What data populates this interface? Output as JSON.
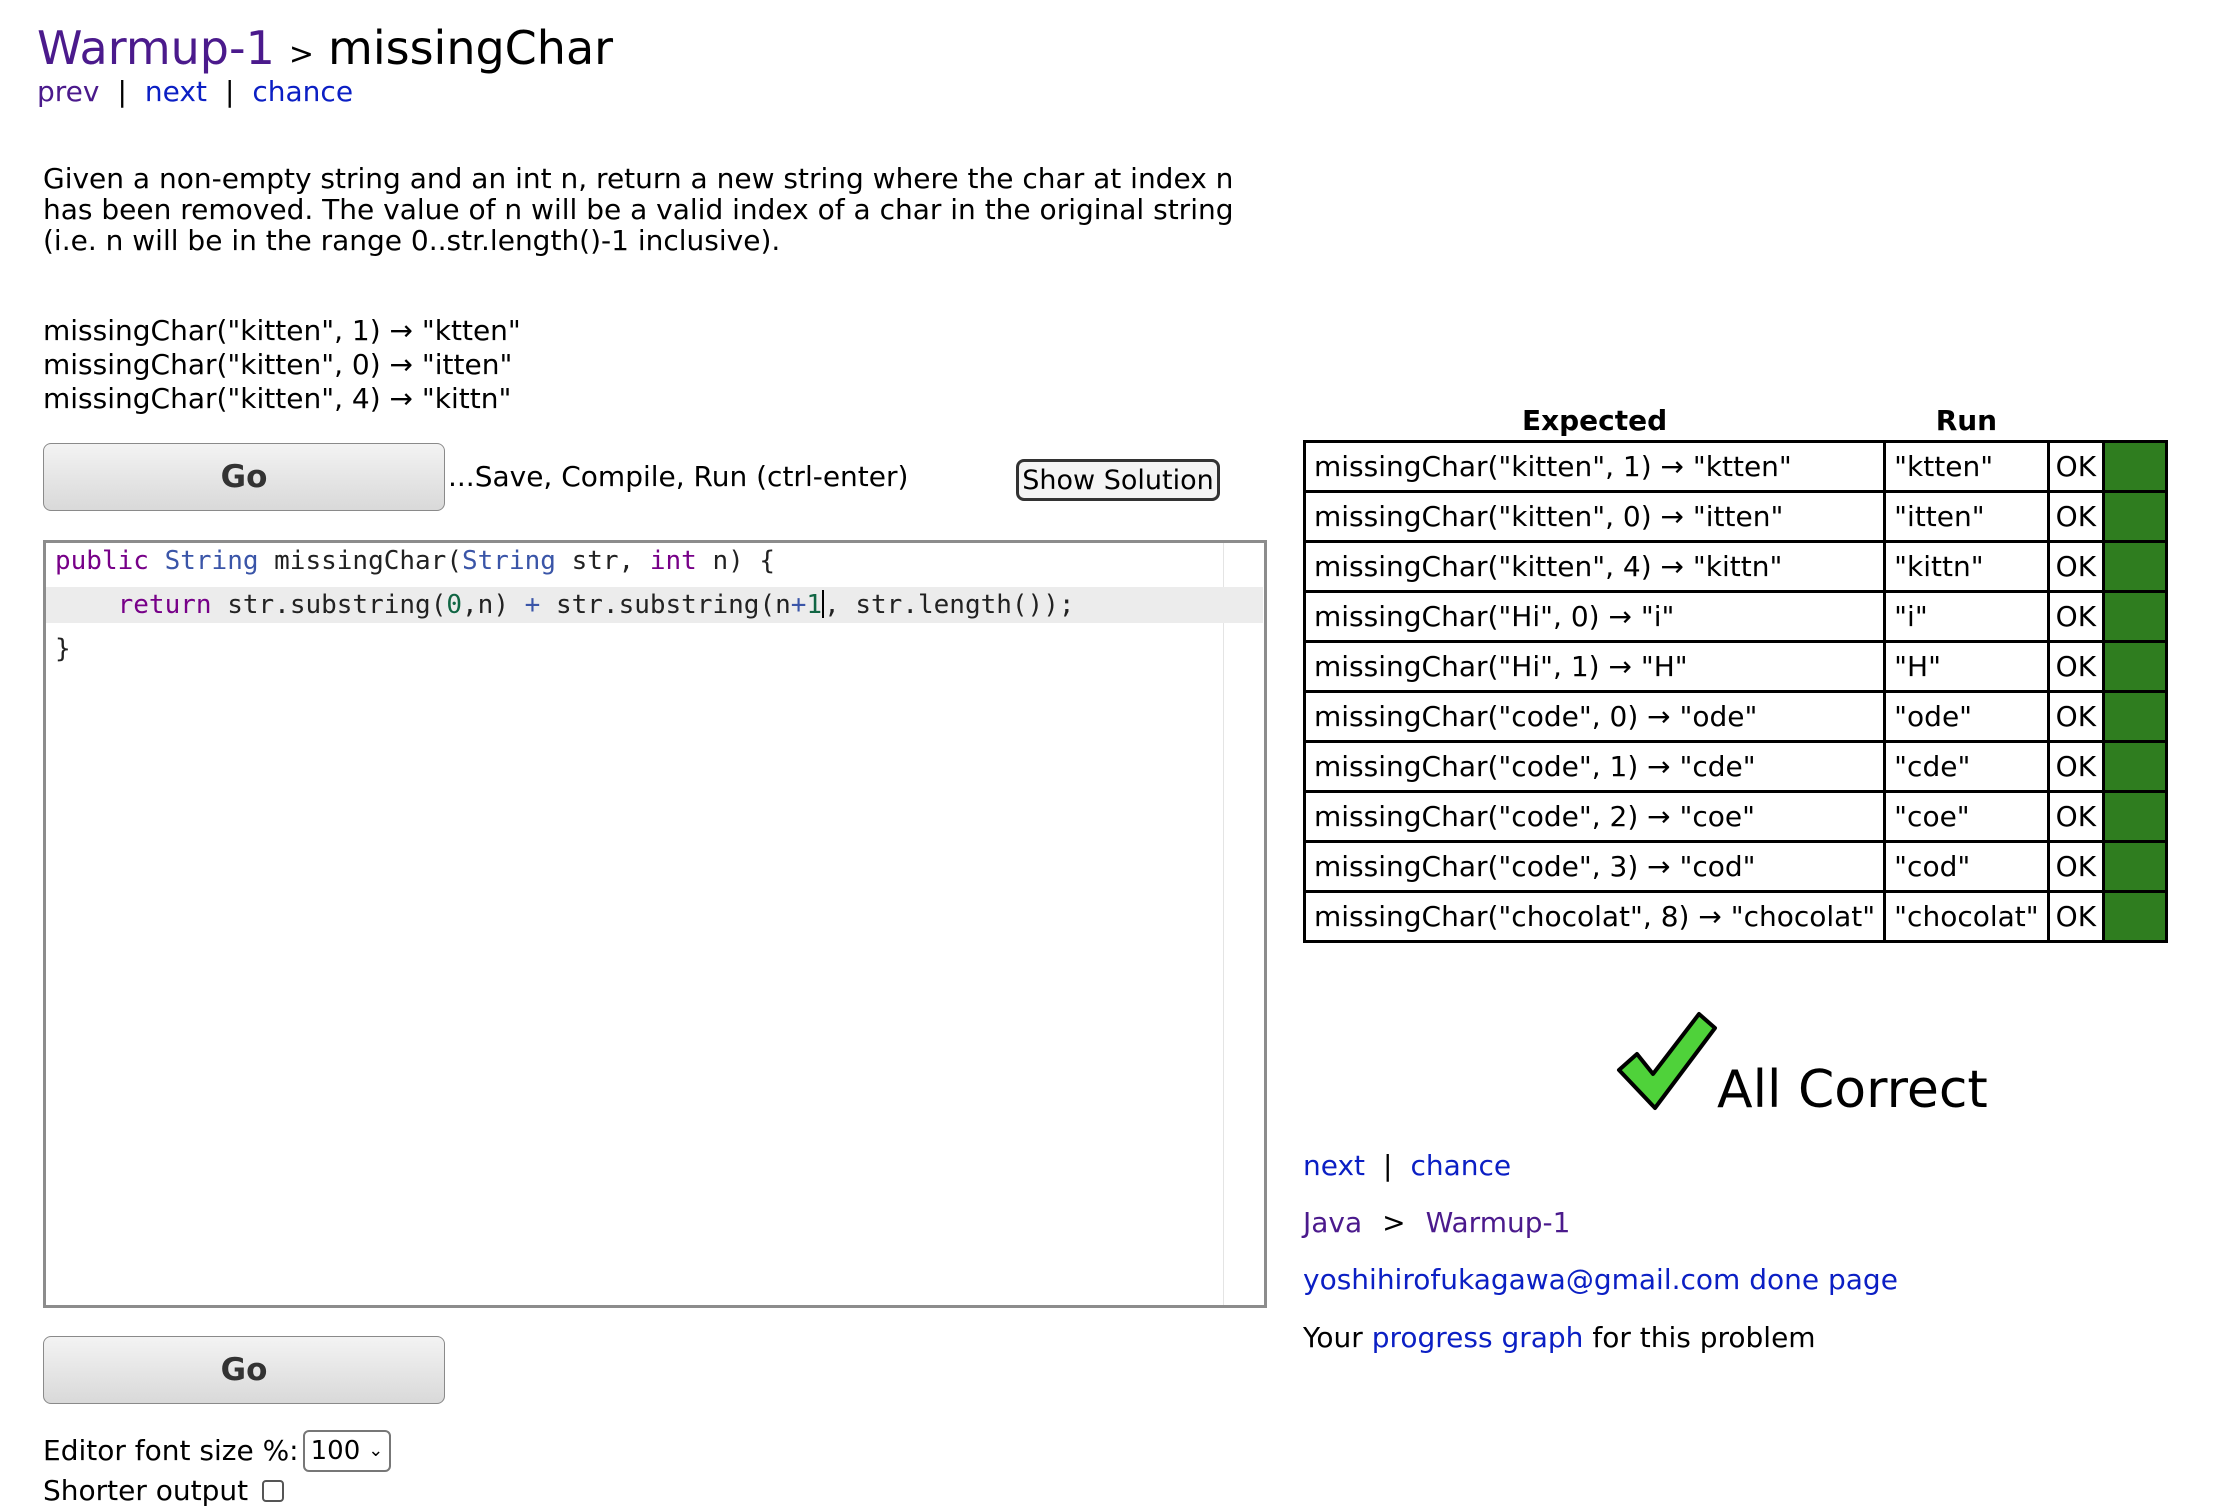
{
  "header": {
    "section": "Warmup-1",
    "separator": ">",
    "problem": "missingChar"
  },
  "top_nav": {
    "prev": "prev",
    "next": "next",
    "chance": "chance",
    "divider": "|"
  },
  "description": "Given a non-empty string and an int n, return a new string where the char at index n has been removed. The value of n will be a valid index of a char in the original string (i.e. n will be in the range 0..str.length()-1 inclusive).",
  "examples": [
    "missingChar(\"kitten\", 1) → \"ktten\"",
    "missingChar(\"kitten\", 0) → \"itten\"",
    "missingChar(\"kitten\", 4) → \"kittn\""
  ],
  "controls": {
    "go_label": "Go",
    "save_label": "...Save, Compile, Run (ctrl-enter)",
    "show_solution_label": "Show Solution"
  },
  "editor": {
    "line1": {
      "kw_public": "public",
      "ty_string": "String",
      "name": " missingChar(",
      "ty_string2": "String",
      "str_param": " str, ",
      "kw_int": "int",
      "tail": " n) {"
    },
    "line2": {
      "indent": "    ",
      "kw_return": "return",
      "part1": " str.substring(",
      "num0": "0",
      "part2": ",n) ",
      "plus": "+",
      "part3": " str.substring(n",
      "plus2": "+",
      "num1": "1",
      "part4": ", str.length());"
    },
    "line3": "}"
  },
  "settings": {
    "font_size_label": "Editor font size %:",
    "font_size_value": "100",
    "shorter_output_label": "Shorter output",
    "shorter_output_checked": false
  },
  "results": {
    "headers": {
      "expected": "Expected",
      "run": "Run"
    },
    "rows": [
      {
        "expected": "missingChar(\"kitten\", 1) → \"ktten\"",
        "run": "\"ktten\"",
        "status": "OK"
      },
      {
        "expected": "missingChar(\"kitten\", 0) → \"itten\"",
        "run": "\"itten\"",
        "status": "OK"
      },
      {
        "expected": "missingChar(\"kitten\", 4) → \"kittn\"",
        "run": "\"kittn\"",
        "status": "OK"
      },
      {
        "expected": "missingChar(\"Hi\", 0) → \"i\"",
        "run": "\"i\"",
        "status": "OK"
      },
      {
        "expected": "missingChar(\"Hi\", 1) → \"H\"",
        "run": "\"H\"",
        "status": "OK"
      },
      {
        "expected": "missingChar(\"code\", 0) → \"ode\"",
        "run": "\"ode\"",
        "status": "OK"
      },
      {
        "expected": "missingChar(\"code\", 1) → \"cde\"",
        "run": "\"cde\"",
        "status": "OK"
      },
      {
        "expected": "missingChar(\"code\", 2) → \"coe\"",
        "run": "\"coe\"",
        "status": "OK"
      },
      {
        "expected": "missingChar(\"code\", 3) → \"cod\"",
        "run": "\"cod\"",
        "status": "OK"
      },
      {
        "expected": "missingChar(\"chocolat\", 8) → \"chocolat\"",
        "run": "\"chocolat\"",
        "status": "OK"
      }
    ],
    "pass_color": "#2f7d1f",
    "summary": "All Correct",
    "summary_icon": "checkmark-icon"
  },
  "right_nav": {
    "next": "next",
    "divider": "|",
    "chance": "chance"
  },
  "breadcrumb": {
    "language": "Java",
    "separator": ">",
    "section": "Warmup-1"
  },
  "account": {
    "email": "yoshihirofukagawa@gmail.com",
    "done_page": "done page"
  },
  "progress": {
    "prefix": "Your ",
    "link": "progress graph",
    "suffix": " for this problem"
  },
  "colors": {
    "link": "#0b1fc4",
    "visited": "#4b1a8c",
    "check_fill": "#4fd23a"
  }
}
